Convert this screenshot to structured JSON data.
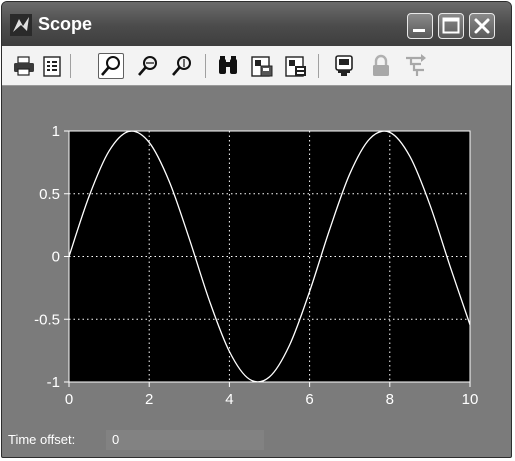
{
  "window": {
    "title": "Scope",
    "app_icon": "simulink-icon",
    "controls": [
      "minimize-icon",
      "maximize-icon",
      "close-icon"
    ]
  },
  "toolbar": {
    "items": [
      {
        "name": "print",
        "icon": "printer-icon"
      },
      {
        "name": "parameters",
        "icon": "parameters-icon"
      },
      {
        "name": "zoom",
        "icon": "magnifier-icon",
        "pressed": true
      },
      {
        "name": "zoom-x",
        "icon": "magnifier-x-icon"
      },
      {
        "name": "zoom-y",
        "icon": "magnifier-y-icon"
      },
      {
        "name": "autoscale",
        "icon": "binoculars-icon"
      },
      {
        "name": "save-axes-settings",
        "icon": "save-axes-icon"
      },
      {
        "name": "restore-axes-settings",
        "icon": "restore-axes-icon"
      },
      {
        "name": "floating-scope",
        "icon": "floating-scope-icon"
      },
      {
        "name": "lock-axes",
        "icon": "lock-icon"
      },
      {
        "name": "signal-selection",
        "icon": "signal-selection-icon"
      }
    ]
  },
  "chart_data": {
    "type": "line",
    "title": "",
    "xlabel": "",
    "ylabel": "",
    "xlim": [
      0,
      10
    ],
    "ylim": [
      -1,
      1
    ],
    "x_ticks": [
      "0",
      "2",
      "4",
      "6",
      "8",
      "10"
    ],
    "y_ticks": [
      "1",
      "0.5",
      "0",
      "-0.5",
      "-1"
    ],
    "grid": true,
    "background": "#000000",
    "line_color": "#ffffff",
    "series": [
      {
        "x": [
          0,
          0.5,
          1,
          1.5,
          2,
          2.5,
          3,
          3.5,
          4,
          4.5,
          5,
          5.5,
          6,
          6.5,
          7,
          7.5,
          8,
          8.5,
          9,
          9.5,
          10
        ],
        "values": [
          0,
          0.479,
          0.841,
          0.997,
          0.909,
          0.598,
          0.141,
          -0.351,
          -0.757,
          -0.978,
          -0.959,
          -0.706,
          -0.279,
          0.215,
          0.657,
          0.938,
          0.989,
          0.798,
          0.412,
          -0.075,
          -0.544
        ]
      }
    ]
  },
  "status": {
    "time_offset_label": "Time offset:",
    "time_offset_value": "0"
  }
}
